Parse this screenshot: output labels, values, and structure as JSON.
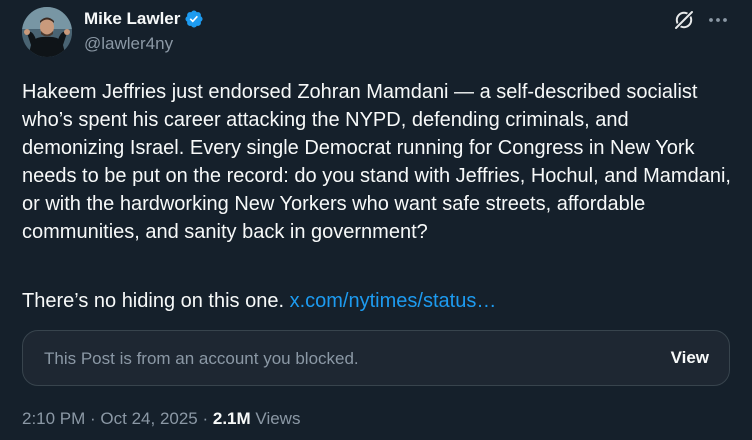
{
  "author": {
    "display_name": "Mike Lawler",
    "handle": "@lawler4ny",
    "verified": true,
    "verified_color": "#1d9bf0",
    "avatar_icon": "avatar-photo"
  },
  "header_icons": {
    "grok": "grok-icon",
    "more": "more-icon"
  },
  "post": {
    "text": "Hakeem Jeffries just endorsed Zohran Mamdani — a self-described socialist who’s spent his career attacking the NYPD, defending criminals, and demonizing Israel. Every single Democrat running for Congress in New York needs to be put on the record: do you stand with Jeffries, Hochul, and Mamdani, or with the hardworking New Yorkers who want safe streets, affordable communities, and sanity back in government?",
    "trailer": "There’s no hiding on this one.",
    "link_text": "x.com/nytimes/status…",
    "link_color": "#1d9bf0"
  },
  "blocked_card": {
    "message": "This Post is from an account you blocked.",
    "view_label": "View"
  },
  "meta": {
    "time": "2:10 PM",
    "separator": " · ",
    "date": "Oct 24, 2025",
    "views_count": "2.1M",
    "views_label": "Views"
  },
  "colors": {
    "background": "#15202b",
    "primary_text": "#f7f9f9",
    "secondary_text": "#8b98a5",
    "card_border": "#38444d"
  }
}
